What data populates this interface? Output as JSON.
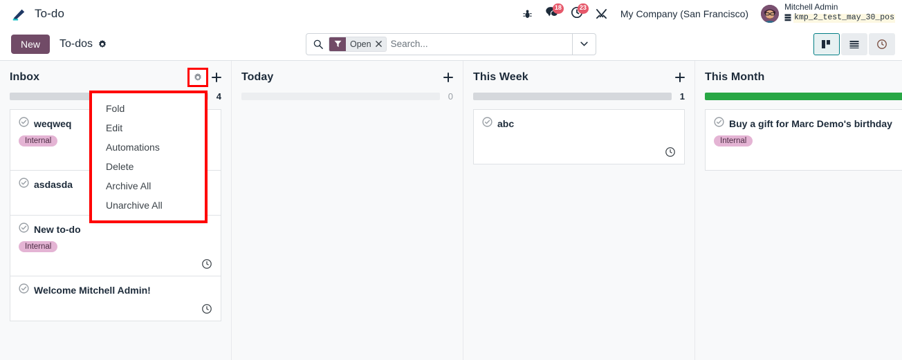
{
  "navbar": {
    "brand": "To-do",
    "brand_icon": "pencil-icon",
    "bug_icon": "bug-icon",
    "messages_icon": "chat-icon",
    "messages_count": "18",
    "activities_icon": "clock-icon",
    "activities_count": "23",
    "apps_icon": "tools-icon",
    "company": "My Company (San Francisco)",
    "user_name": "Mitchell Admin",
    "db_name": "kmp_2_test_may_30_pos",
    "db_icon": "database-icon",
    "avatar": "avatar"
  },
  "control_panel": {
    "new_label": "New",
    "breadcrumb_title": "To-dos",
    "breadcrumb_gear": "gear-icon",
    "search": {
      "icon": "search-icon",
      "facet_icon": "filter-icon",
      "facet_label": "Open",
      "facet_remove": "close-icon",
      "placeholder": "Search...",
      "value": "",
      "toggle_icon": "chevron-down-icon"
    },
    "views": [
      {
        "name": "kanban",
        "icon": "kanban-icon",
        "active": true
      },
      {
        "name": "list",
        "icon": "list-icon",
        "active": false
      },
      {
        "name": "activity",
        "icon": "clock-icon",
        "active": false
      }
    ]
  },
  "columns": [
    {
      "title": "Inbox",
      "count": "4",
      "progress": "grey",
      "gear_icon": "gear-icon",
      "gear_highlighted": true,
      "plus_icon": "plus-icon",
      "cards": [
        {
          "title": "weqweq",
          "check_icon": "check-circle-icon",
          "tag": "Internal",
          "footer_icon": ""
        },
        {
          "title": "asdasda",
          "check_icon": "check-circle-icon",
          "tag": "",
          "footer_icon": ""
        },
        {
          "title": "New to-do",
          "check_icon": "check-circle-icon",
          "tag": "Internal",
          "footer_icon": "clock-icon"
        },
        {
          "title": "Welcome Mitchell Admin!",
          "check_icon": "check-circle-icon",
          "tag": "",
          "footer_icon": "clock-icon"
        }
      ]
    },
    {
      "title": "Today",
      "count": "0",
      "progress": "empty",
      "gear_icon": "",
      "gear_highlighted": false,
      "plus_icon": "plus-icon",
      "cards": []
    },
    {
      "title": "This Week",
      "count": "1",
      "progress": "grey",
      "gear_icon": "",
      "gear_highlighted": false,
      "plus_icon": "plus-icon",
      "cards": [
        {
          "title": "abc",
          "check_icon": "check-circle-icon",
          "tag": "",
          "footer_icon": "clock-icon"
        }
      ]
    },
    {
      "title": "This Month",
      "count": "",
      "progress": "green",
      "gear_icon": "",
      "gear_highlighted": false,
      "plus_icon": "",
      "cards": [
        {
          "title": "Buy a gift for Marc Demo's birthday",
          "check_icon": "check-circle-icon",
          "tag": "Internal",
          "footer_icon": "todo-green-icon"
        }
      ]
    }
  ],
  "dropdown": {
    "items": [
      "Fold",
      "Edit",
      "Automations",
      "Delete",
      "Archive All",
      "Unarchive All"
    ]
  },
  "colors": {
    "primary": "#714b67",
    "accent_teal": "#017e84",
    "badge_red": "#e6586a",
    "tag_pink": "#e4b4d4",
    "progress_green": "#28a745",
    "highlight_red": "#ff0000"
  }
}
